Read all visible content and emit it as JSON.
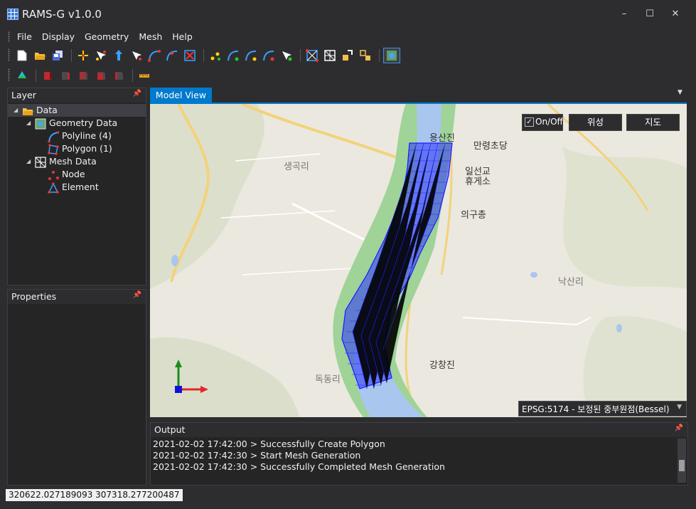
{
  "app": {
    "title": "RAMS-G v1.0.0"
  },
  "window_controls": {
    "minimize": "–",
    "maximize": "☐",
    "close": "✕"
  },
  "menu": [
    "File",
    "Display",
    "Geometry",
    "Mesh",
    "Help"
  ],
  "toolbar1": [
    "new-file-icon",
    "open-folder-icon",
    "save-icon",
    "add-point-icon",
    "select-point-icon",
    "move-point-icon",
    "edit-point-icon",
    "add-polyline-icon",
    "edit-polyline-icon",
    "delete-polyline-icon",
    "polyline-node-icon",
    "polyline-split-icon",
    "polyline-join-icon",
    "polyline-move-icon",
    "polyline-select-icon",
    "polygon-icon",
    "mesh-grid-icon",
    "mesh-export-icon",
    "mesh-settings-icon",
    "map-toggle-icon"
  ],
  "toolbar2": [
    "layer-color-icon",
    "cube-red-1-icon",
    "cube-red-2-icon",
    "cube-red-3-icon",
    "cube-red-4-icon",
    "cube-red-5-icon",
    "ruler-icon"
  ],
  "layer_panel": {
    "title": "Layer",
    "tree": [
      {
        "label": "Data",
        "icon": "folder-icon"
      },
      {
        "label": "Geometry Data",
        "icon": "geometry-icon"
      },
      {
        "label": "Polyline (4)",
        "icon": "polyline-icon"
      },
      {
        "label": "Polygon (1)",
        "icon": "polygon-icon"
      },
      {
        "label": "Mesh Data",
        "icon": "mesh-icon"
      },
      {
        "label": "Node",
        "icon": "node-icon"
      },
      {
        "label": "Element",
        "icon": "element-icon"
      }
    ]
  },
  "properties_panel": {
    "title": "Properties"
  },
  "model_view": {
    "tab_label": "Model View",
    "onoff_label": "On/Off",
    "onoff_checked": true,
    "satellite_label": "위성",
    "map_label": "지도",
    "crs_label": "EPSG:5174 - 보정된 중부원점(Bessel)",
    "map_labels": [
      "용산진",
      "만령초당",
      "일선교",
      "휴게소",
      "의구총",
      "생곡리",
      "낙산리",
      "강창진",
      "독동리"
    ]
  },
  "output_panel": {
    "title": "Output",
    "lines": [
      "2021-02-02 17:42:00 > Successfully Create Polygon",
      "2021-02-02 17:42:30 > Start Mesh Generation",
      "2021-02-02 17:42:30 > Successfully Completed Mesh Generation"
    ]
  },
  "status": {
    "coordinates": "320622.027189093 307318.277200487"
  },
  "colors": {
    "accent": "#007acc",
    "mesh": "#1a1aff",
    "river": "#a9c6ee",
    "riverbank": "#8fcf8a"
  }
}
